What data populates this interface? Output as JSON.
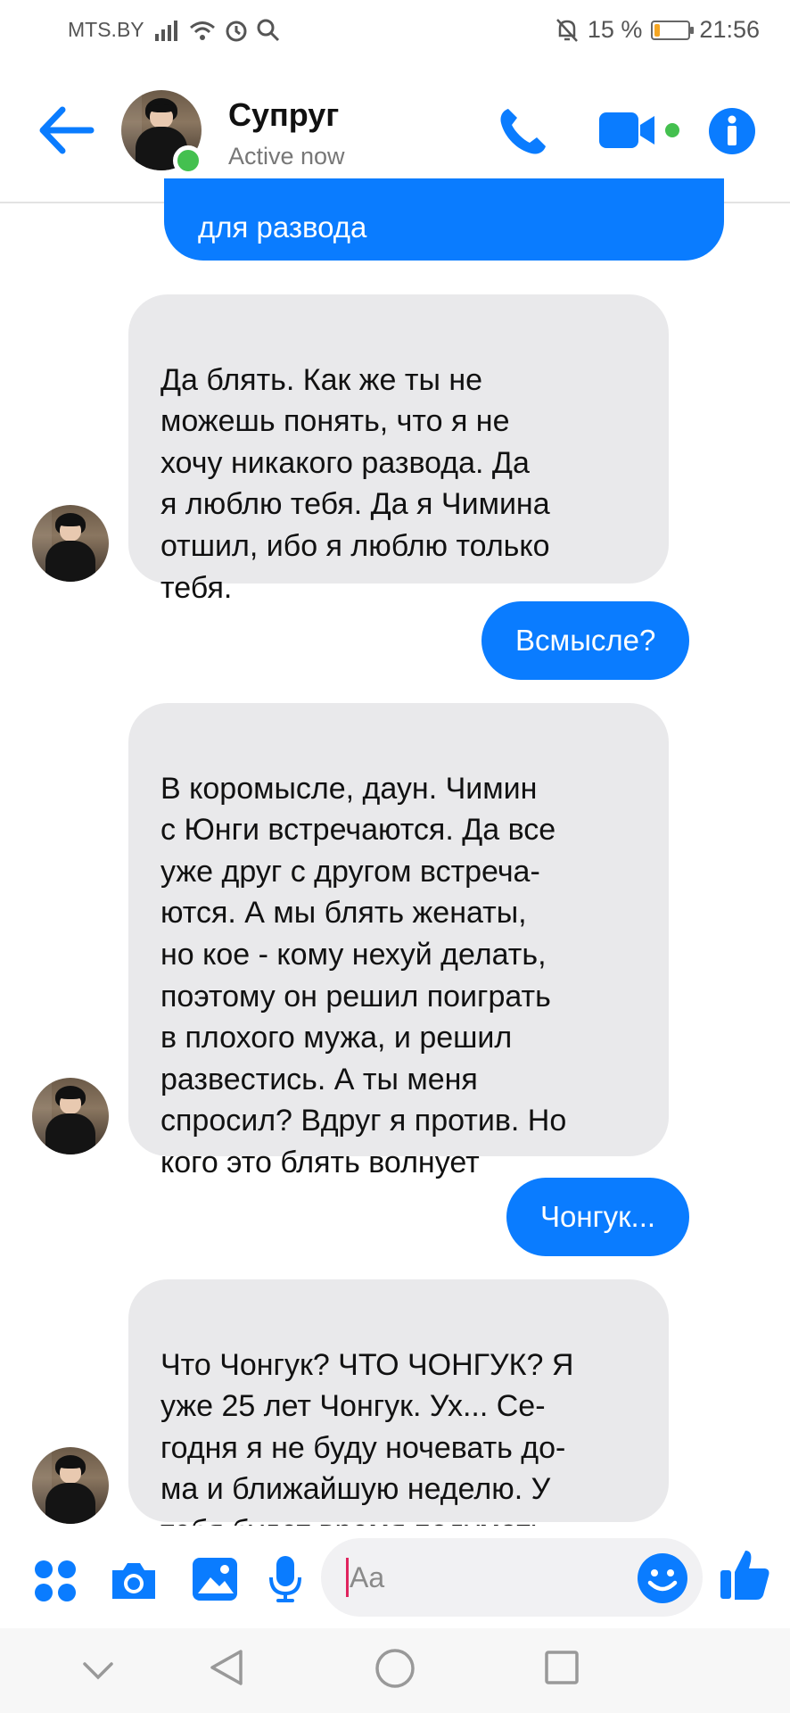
{
  "status_bar": {
    "carrier": "MTS.BY",
    "battery_percent_text": "15 %",
    "battery_level": 0.15,
    "time": "21:56"
  },
  "header": {
    "contact_name": "Супруг",
    "status": "Active now"
  },
  "messages": [
    {
      "from": "me",
      "text": "для развода"
    },
    {
      "from": "them",
      "text": "Да блять. Как же ты не\nможешь понять, что я не\nхочу никакого развода. Да\nя люблю тебя. Да я Чимина\nотшил, ибо я люблю только\nтебя."
    },
    {
      "from": "me",
      "text": "Всмысле?"
    },
    {
      "from": "them",
      "text": "В коромысле, даун. Чимин\nс Юнги встречаются. Да все\nуже друг с другом встреча-\nются. А мы блять женаты,\nно кое - кому нехуй делать,\nпоэтому он решил поиграть\nв плохого мужа, и решил\nразвестись. А ты меня\nспросил? Вдруг я против. Но\nкого это блять волнует"
    },
    {
      "from": "me",
      "text": "Чонгук..."
    },
    {
      "from": "them",
      "text": "Что Чонгук? ЧТО ЧОНГУК? Я\nуже 25 лет Чонгук. Ух... Се-\nгодня я не буду ночевать до-\nма и ближайшую неделю. У\nтебя будет время подумать"
    }
  ],
  "composer": {
    "placeholder": "Aa"
  },
  "colors": {
    "accent": "#0a7cff",
    "incoming_bubble": "#e9e9eb",
    "online": "#44c04f"
  }
}
